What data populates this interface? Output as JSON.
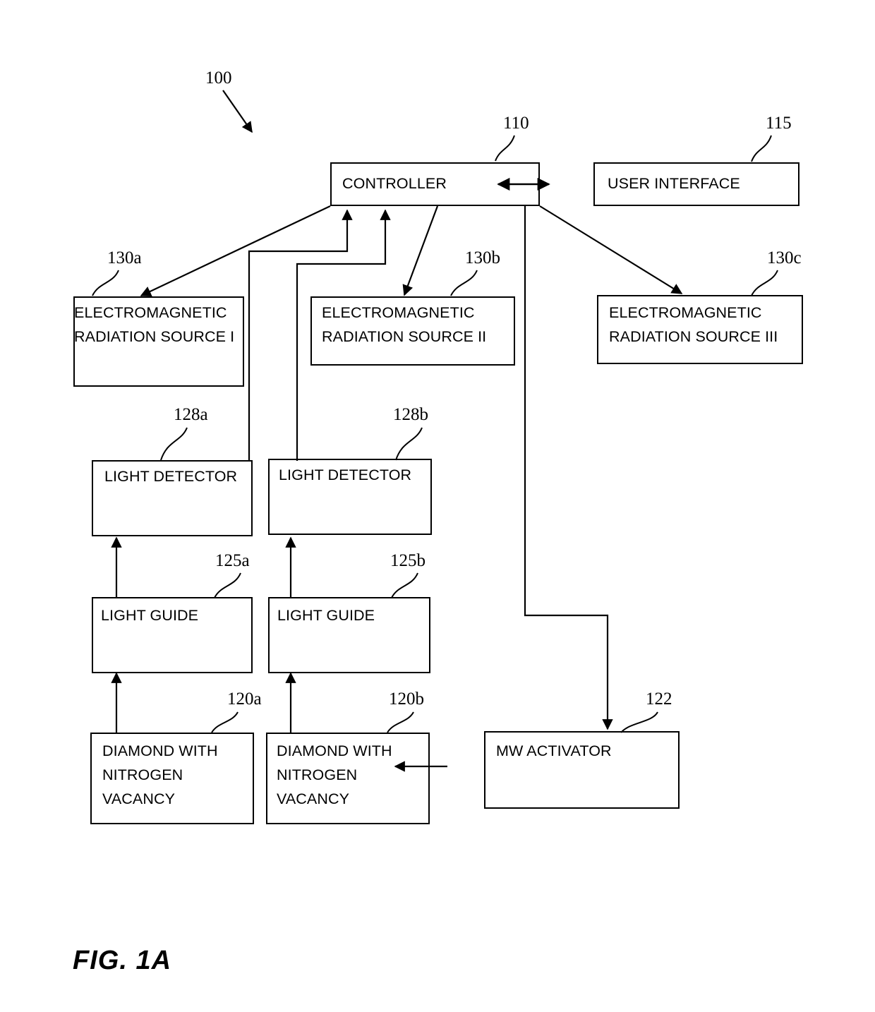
{
  "figure": {
    "caption": "FIG. 1A",
    "system_ref": "100"
  },
  "nodes": {
    "controller": {
      "label": "CONTROLLER",
      "ref": "110"
    },
    "user_interface": {
      "label": "USER INTERFACE",
      "ref": "115"
    },
    "em_source_1": {
      "label_line1": "ELECTROMAGNETIC",
      "label_line2": "RADIATION SOURCE I",
      "ref": "130a"
    },
    "em_source_2": {
      "label_line1": "ELECTROMAGNETIC",
      "label_line2": "RADIATION SOURCE II",
      "ref": "130b"
    },
    "em_source_3": {
      "label_line1": "ELECTROMAGNETIC",
      "label_line2": "RADIATION SOURCE III",
      "ref": "130c"
    },
    "light_detector_a": {
      "label": "LIGHT DETECTOR",
      "ref": "128a"
    },
    "light_detector_b": {
      "label": "LIGHT DETECTOR",
      "ref": "128b"
    },
    "light_guide_a": {
      "label": "LIGHT GUIDE",
      "ref": "125a"
    },
    "light_guide_b": {
      "label": "LIGHT GUIDE",
      "ref": "125b"
    },
    "diamond_a": {
      "label_line1": "DIAMOND WITH",
      "label_line2": "NITROGEN",
      "label_line3": "VACANCY",
      "ref": "120a"
    },
    "diamond_b": {
      "label_line1": "DIAMOND WITH",
      "label_line2": "NITROGEN",
      "label_line3": "VACANCY",
      "ref": "120b"
    },
    "mw_activator": {
      "label": "MW ACTIVATOR",
      "ref": "122"
    }
  },
  "colors": {
    "stroke": "#000000",
    "background": "#ffffff"
  }
}
